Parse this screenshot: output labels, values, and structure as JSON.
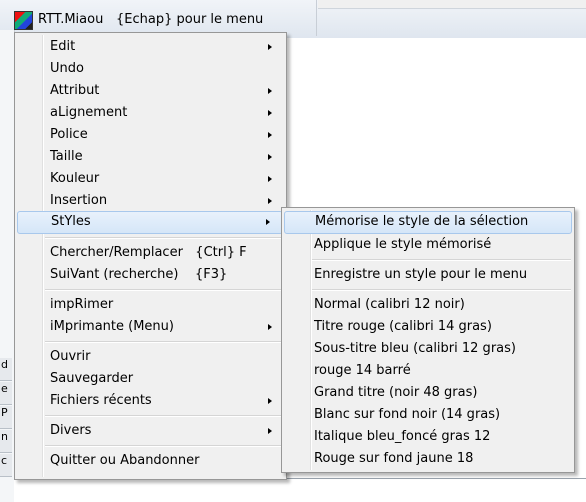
{
  "app": {
    "title": "RTT.Miaou",
    "hint": "{Echap} pour le menu",
    "icon": "rtt-app-icon"
  },
  "left_strip": [
    "d",
    "e",
    "P",
    "n",
    "c"
  ],
  "main_menu": [
    {
      "label": "Edit",
      "submenu": true
    },
    {
      "label": "Undo",
      "submenu": false
    },
    {
      "label": "Attribut",
      "submenu": true
    },
    {
      "label": "aLignement",
      "submenu": true
    },
    {
      "label": "Police",
      "submenu": true
    },
    {
      "label": "Taille",
      "submenu": true
    },
    {
      "label": "Kouleur",
      "submenu": true
    },
    {
      "label": "Insertion",
      "submenu": true
    },
    {
      "label": "StYles",
      "submenu": true,
      "highlighted": true
    },
    {
      "label": "Chercher/Remplacer   {Ctrl} F",
      "submenu": false
    },
    {
      "label": "SuiVant (recherche)    {F3}",
      "submenu": false
    },
    {
      "label": "impRimer",
      "submenu": false
    },
    {
      "label": "iMprimante (Menu)",
      "submenu": true
    },
    {
      "label": "Ouvrir",
      "submenu": false
    },
    {
      "label": "Sauvegarder",
      "submenu": false
    },
    {
      "label": "Fichiers récents",
      "submenu": true
    },
    {
      "label": "Divers",
      "submenu": true
    },
    {
      "label": "Quitter ou Abandonner",
      "submenu": false
    }
  ],
  "styles_menu": [
    {
      "label": "Mémorise le style de la sélection",
      "highlighted": true
    },
    {
      "label": "Applique le style mémorisé"
    },
    {
      "label": "Enregistre un style pour le menu"
    },
    {
      "label": "Normal (calibri 12 noir)"
    },
    {
      "label": "Titre rouge (calibri 14 gras)"
    },
    {
      "label": "Sous-titre bleu (calibri 12 gras)"
    },
    {
      "label": "rouge 14 barré"
    },
    {
      "label": "Grand titre (noir 48 gras)"
    },
    {
      "label": "Blanc sur fond noir (14 gras)"
    },
    {
      "label": "Italique bleu_foncé gras 12"
    },
    {
      "label": "Rouge sur fond jaune 18"
    }
  ],
  "colors": {
    "menu_bg": "#f0f0f0",
    "highlight_bg": "#dce9f8",
    "highlight_border": "#a8c8ec"
  }
}
